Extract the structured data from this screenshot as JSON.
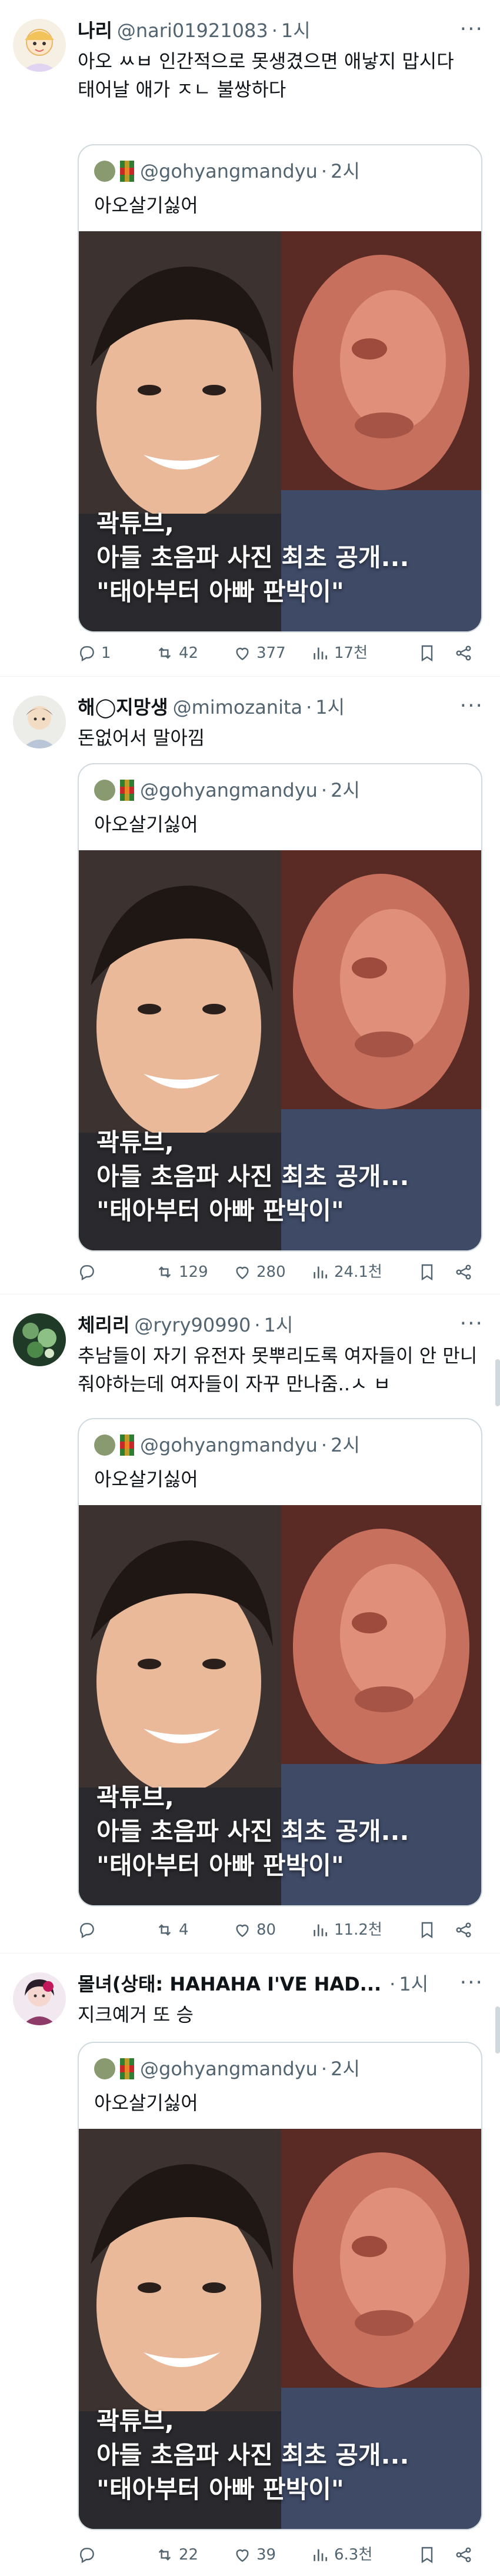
{
  "quoted": {
    "handle": "@gohyangmandyu",
    "time": "2시",
    "text": "아오살기싫어",
    "caption_lines": [
      "곽튜브,",
      "아들 초음파 사진 최초 공개...",
      "\"태아부터 아빠 판박이\""
    ]
  },
  "separator": "·",
  "more_icon": "···",
  "tweets": [
    {
      "display_name": "나리",
      "handle": "@nari01921083",
      "time": "1시",
      "text": "아오 ㅆㅂ 인간적으로 못생겼으면 애낳지 맙시다\n태어날 애가 ㅈㄴ 불쌍하다",
      "replies": "1",
      "retweets": "42",
      "likes": "377",
      "views": "17천"
    },
    {
      "display_name": "해◯지망생",
      "handle": "@mimozanita",
      "time": "1시",
      "text": "돈없어서 말아낌",
      "replies": "",
      "retweets": "129",
      "likes": "280",
      "views": "24.1천"
    },
    {
      "display_name": "체리리",
      "handle": "@ryry90990",
      "time": "1시",
      "text": "추남들이 자기 유전자 못뿌리도록 여자들이 안 만니줘야하는데 여자들이 자꾸 만나줌..ㅅ ㅂ",
      "replies": "",
      "retweets": "4",
      "likes": "80",
      "views": "11.2천"
    },
    {
      "display_name": "몰녀(상태: HAHAHA I'VE HAD...",
      "handle": "",
      "time": "1시",
      "text": "지크예거 또 승",
      "replies": "",
      "retweets": "22",
      "likes": "39",
      "views": "6.3천"
    }
  ],
  "icons": {
    "reply": "reply-icon",
    "retweet": "retweet-icon",
    "like": "heart-icon",
    "views": "views-icon",
    "bookmark": "bookmark-icon",
    "share": "share-icon",
    "more": "more-icon"
  },
  "colors": {
    "text": "#0f1419",
    "secondary": "#536471",
    "border": "#cfd9de",
    "divider": "#eff3f4"
  }
}
